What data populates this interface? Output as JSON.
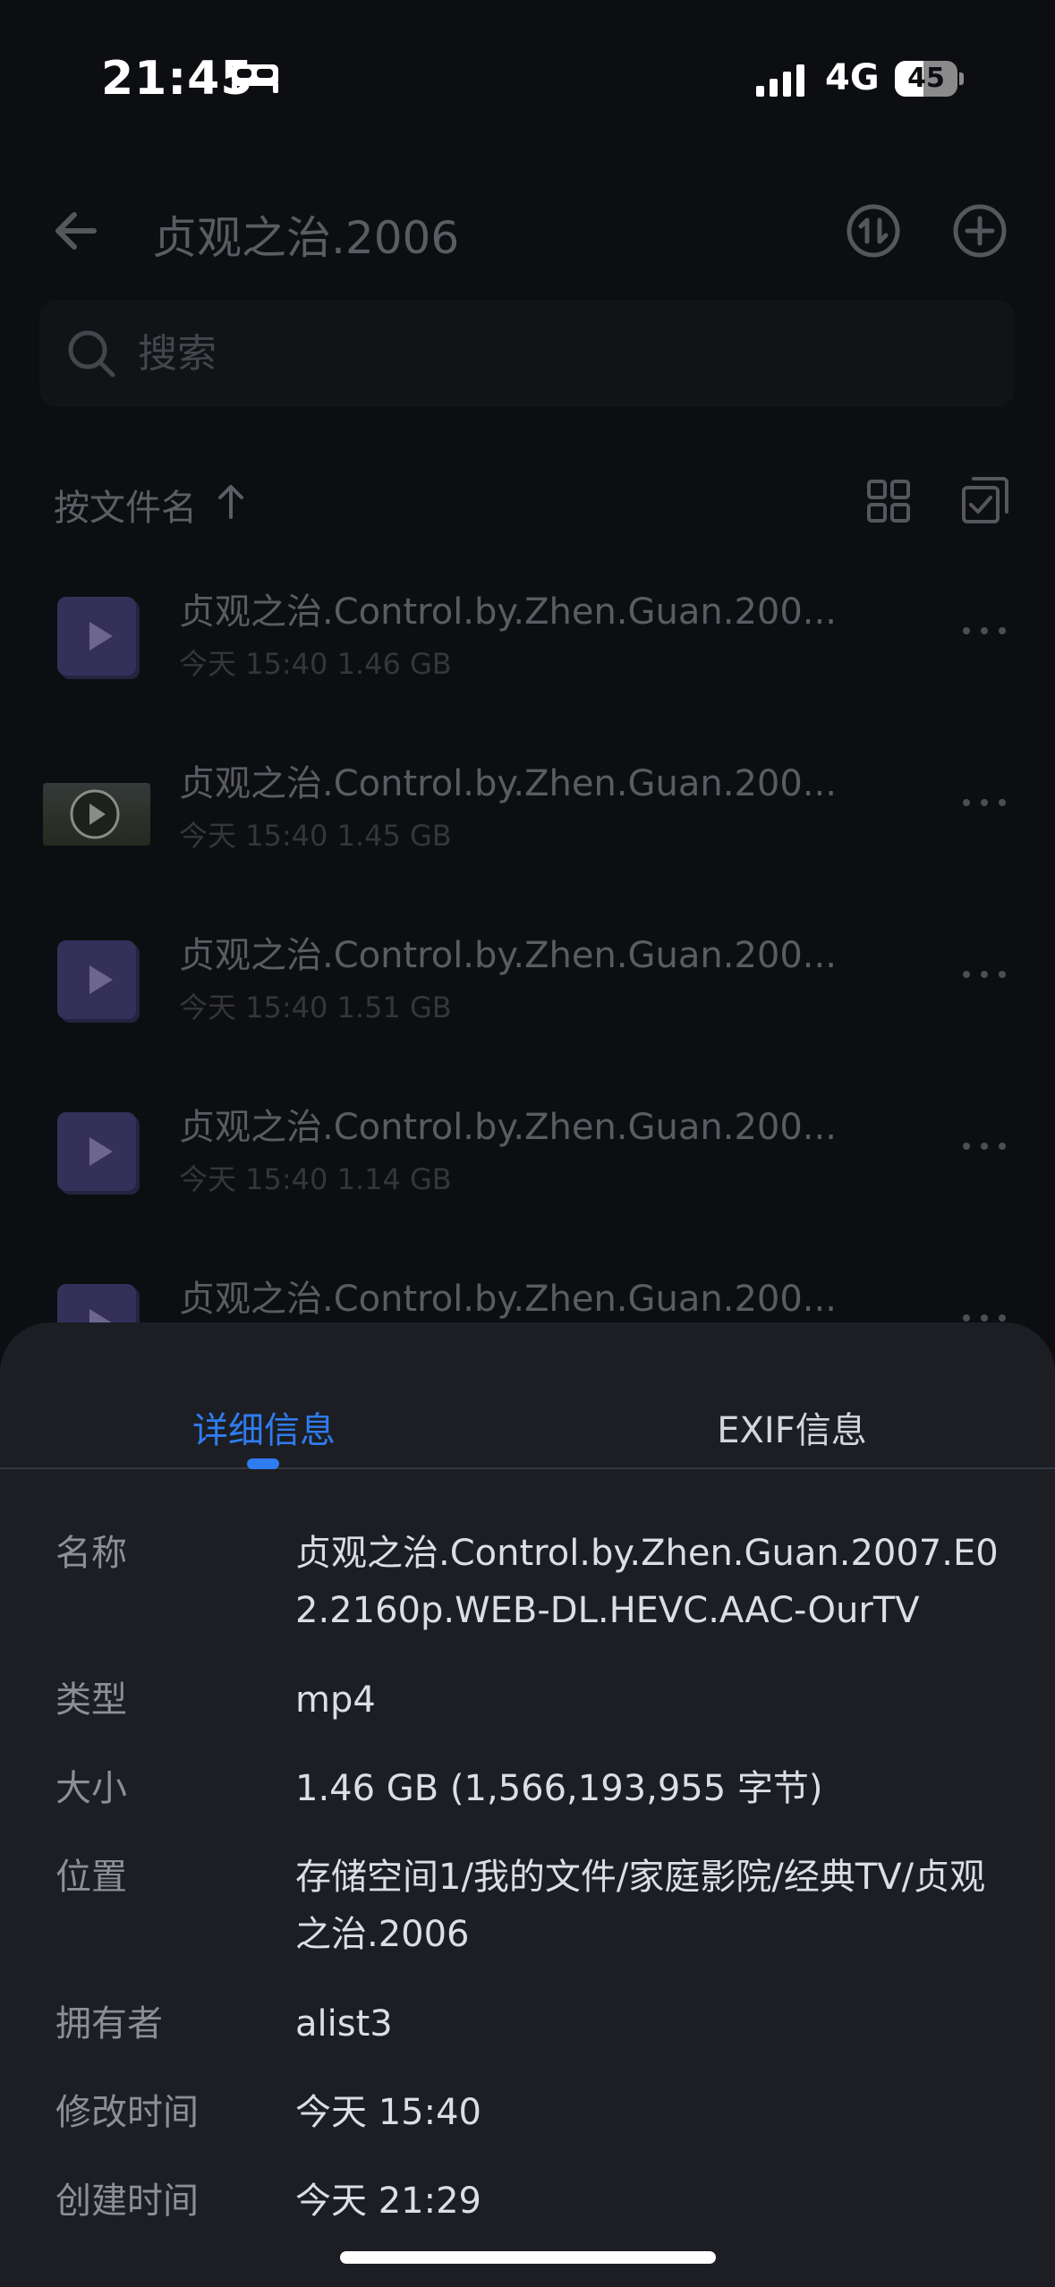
{
  "status_bar": {
    "time": "21:45",
    "network": "4G",
    "battery_level": "45",
    "battery_fraction": 0.45
  },
  "nav": {
    "title": "贞观之治.2006"
  },
  "search": {
    "placeholder": "搜索"
  },
  "sort": {
    "label": "按文件名"
  },
  "files": [
    {
      "name": "贞观之治.Control.by.Zhen.Guan.200...",
      "time": "今天 15:40",
      "size": "1.46 GB"
    },
    {
      "name": "贞观之治.Control.by.Zhen.Guan.200...",
      "time": "今天 15:40",
      "size": "1.45 GB"
    },
    {
      "name": "贞观之治.Control.by.Zhen.Guan.200...",
      "time": "今天 15:40",
      "size": "1.51 GB"
    },
    {
      "name": "贞观之治.Control.by.Zhen.Guan.200...",
      "time": "今天 15:40",
      "size": "1.14 GB"
    },
    {
      "name": "贞观之治.Control.by.Zhen.Guan.200...",
      "time": "",
      "size": ""
    }
  ],
  "sheet": {
    "tabs": [
      "详细信息",
      "EXIF信息"
    ],
    "active_tab": 0,
    "details": [
      {
        "label": "名称",
        "value": "贞观之治.Control.by.Zhen.Guan.2007.E02.2160p.WEB-DL.HEVC.AAC-OurTV"
      },
      {
        "label": "类型",
        "value": "mp4"
      },
      {
        "label": "大小",
        "value": "1.46 GB (1,566,193,955 字节)"
      },
      {
        "label": "位置",
        "value": "存储空间1/我的文件/家庭影院/经典TV/贞观之治.2006"
      },
      {
        "label": "拥有者",
        "value": "alist3"
      },
      {
        "label": "修改时间",
        "value": "今天 15:40"
      },
      {
        "label": "创建时间",
        "value": "今天 21:29"
      }
    ]
  },
  "colors": {
    "accent": "#2f7cf0",
    "sheet_background": "#1c1e24",
    "page_background": "#0d0e12"
  }
}
